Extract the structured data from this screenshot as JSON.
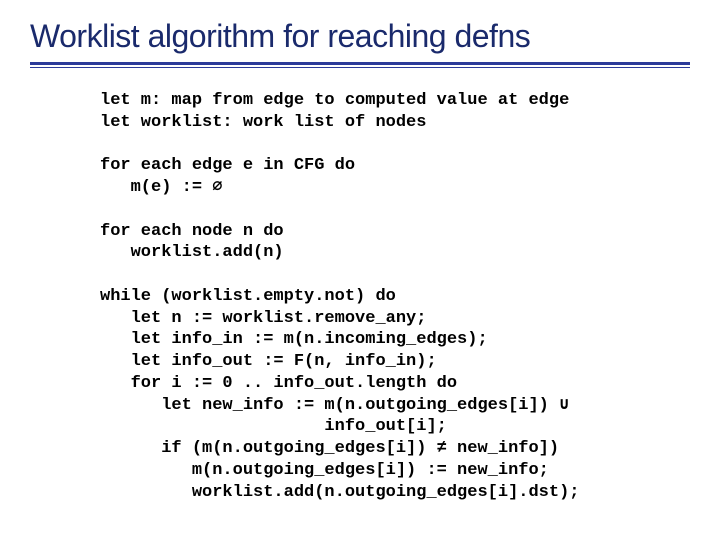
{
  "title": "Worklist algorithm for reaching defns",
  "code": {
    "l1": "let m: map from edge to computed value at edge",
    "l2": "let worklist: work list of nodes",
    "l3": "",
    "l4": "for each edge e in CFG do",
    "l5": "   m(e) := ∅",
    "l6": "",
    "l7": "for each node n do",
    "l8": "   worklist.add(n)",
    "l9": "",
    "l10": "while (worklist.empty.not) do",
    "l11": "   let n := worklist.remove_any;",
    "l12": "   let info_in := m(n.incoming_edges);",
    "l13": "   let info_out := F(n, info_in);",
    "l14": "   for i := 0 .. info_out.length do",
    "l15": "      let new_info := m(n.outgoing_edges[i]) ∪",
    "l16": "                      info_out[i];",
    "l17": "      if (m(n.outgoing_edges[i]) ≠ new_info])",
    "l18": "         m(n.outgoing_edges[i]) := new_info;",
    "l19": "         worklist.add(n.outgoing_edges[i].dst);"
  }
}
